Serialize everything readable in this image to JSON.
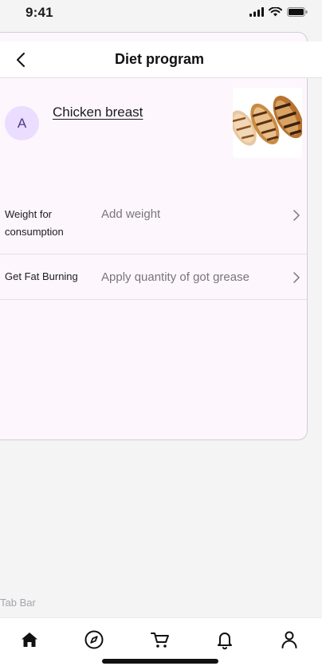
{
  "status_bar": {
    "time": "9:41",
    "icons": [
      "signal-icon",
      "wifi-icon",
      "battery-icon"
    ]
  },
  "header": {
    "title": "Diet program",
    "back_icon": "chevron-left-icon"
  },
  "food": {
    "avatar_letter": "A",
    "name": "Chicken breast",
    "image": "grilled-chicken-breast-image"
  },
  "fields": [
    {
      "label": "Weight for consumption",
      "value": "Add weight",
      "icon": "chevron-right-icon"
    },
    {
      "label": "Get Fat Burning",
      "value": "Apply quantity of got grease",
      "icon": "chevron-right-icon"
    }
  ],
  "tab_bar": {
    "caption": "Tab Bar",
    "tabs": [
      {
        "name": "home",
        "icon": "home-icon"
      },
      {
        "name": "explore",
        "icon": "compass-icon"
      },
      {
        "name": "cart",
        "icon": "cart-icon"
      },
      {
        "name": "notifications",
        "icon": "bell-icon"
      },
      {
        "name": "profile",
        "icon": "person-icon"
      }
    ]
  },
  "colors": {
    "card_background": "#fdf6fd",
    "avatar_background": "#eaddff",
    "avatar_text": "#4f378b",
    "secondary_text": "#79747e"
  }
}
